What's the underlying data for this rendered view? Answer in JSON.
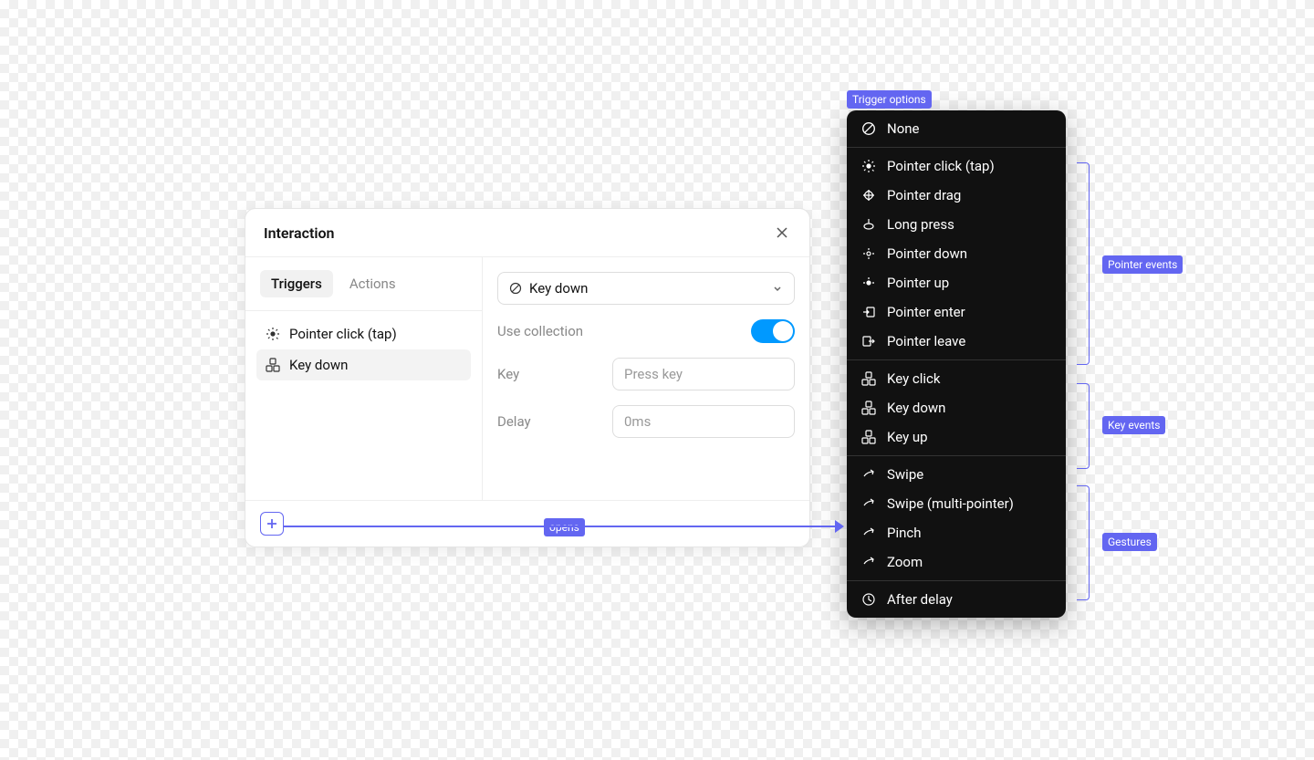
{
  "panel": {
    "title": "Interaction",
    "tabs": {
      "triggers": "Triggers",
      "actions": "Actions"
    },
    "triggers": [
      {
        "label": "Pointer click (tap)"
      },
      {
        "label": "Key down"
      }
    ],
    "dropdown_value": "Key down",
    "use_collection_label": "Use collection",
    "key_label": "Key",
    "key_placeholder": "Press key",
    "delay_label": "Delay",
    "delay_placeholder": "0ms"
  },
  "options_menu": {
    "none": "None",
    "pointer_events": [
      "Pointer click (tap)",
      "Pointer drag",
      "Long press",
      "Pointer down",
      "Pointer up",
      "Pointer enter",
      "Pointer leave"
    ],
    "key_events": [
      "Key click",
      "Key down",
      "Key up"
    ],
    "gestures": [
      "Swipe",
      "Swipe (multi-pointer)",
      "Pinch",
      "Zoom"
    ],
    "after_delay": "After delay"
  },
  "annotations": {
    "trigger_options": "Trigger options",
    "pointer_events": "Pointer events",
    "key_events": "Key events",
    "gestures": "Gestures",
    "opens": "opens"
  }
}
